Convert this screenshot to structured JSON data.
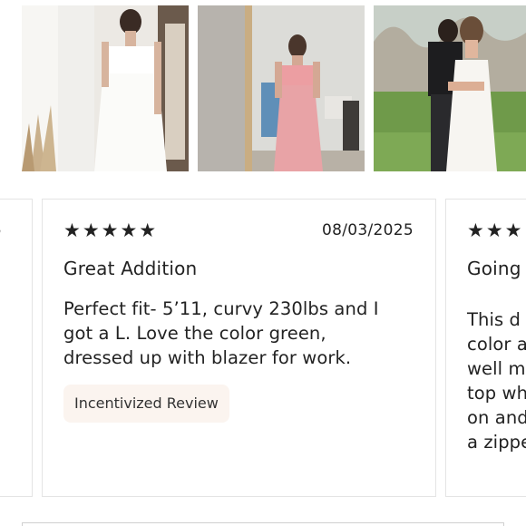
{
  "photos": [
    {
      "alt_icon": "photo-white-dress-mirror"
    },
    {
      "alt_icon": "photo-pink-dress-mirror"
    },
    {
      "alt_icon": "photo-couple-white-dress"
    }
  ],
  "reviews": {
    "left": {
      "date_fragment": "5",
      "line_fragments": [
        "",
        "."
      ]
    },
    "main": {
      "stars": "★★★★★",
      "rating": 5,
      "date": "08/03/2025",
      "title": "Great Addition",
      "body_lines": [
        "Perfect fit- 5’11, curvy 230lbs and I",
        "got a L. Love the color green,",
        "dressed up with blazer for work."
      ],
      "badge": "Incentivized Review"
    },
    "right": {
      "stars": "★★★",
      "title": "Going",
      "body_lines": [
        "This d",
        "color a",
        "well m",
        "top wh",
        "on and",
        "a zippe"
      ]
    }
  }
}
